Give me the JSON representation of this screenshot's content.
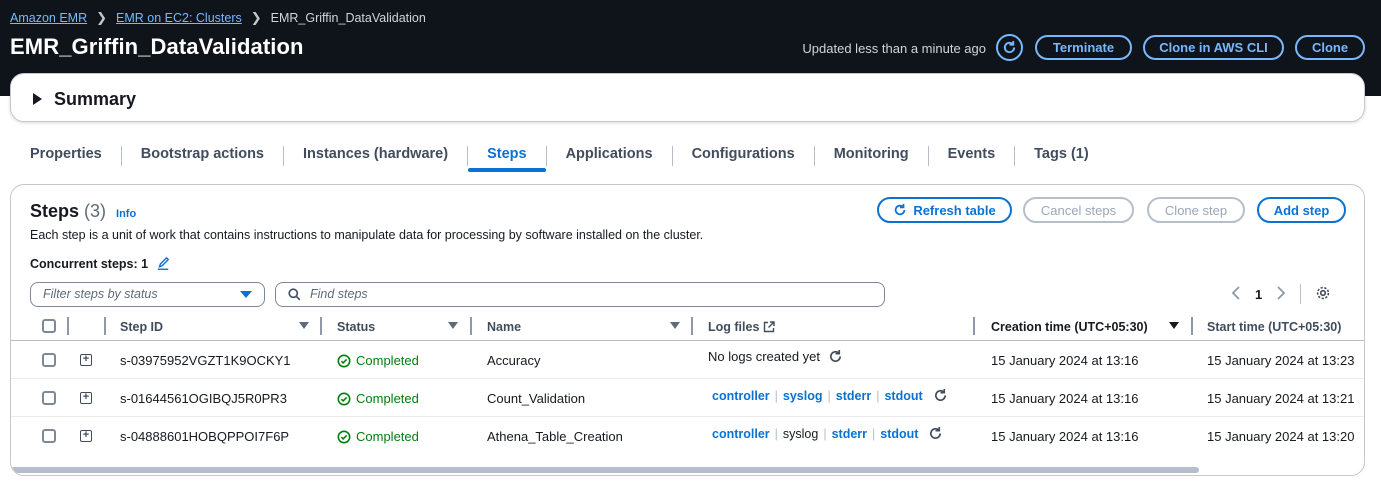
{
  "breadcrumb": {
    "items": [
      "Amazon EMR",
      "EMR on EC2: Clusters"
    ],
    "current": "EMR_Griffin_DataValidation"
  },
  "header": {
    "title": "EMR_Griffin_DataValidation",
    "updated": "Updated less than a minute ago",
    "terminate": "Terminate",
    "clone_cli": "Clone in AWS CLI",
    "clone": "Clone"
  },
  "summary": {
    "label": "Summary"
  },
  "tabs": [
    {
      "label": "Properties"
    },
    {
      "label": "Bootstrap actions"
    },
    {
      "label": "Instances (hardware)"
    },
    {
      "label": "Steps"
    },
    {
      "label": "Applications"
    },
    {
      "label": "Configurations"
    },
    {
      "label": "Monitoring"
    },
    {
      "label": "Events"
    },
    {
      "label": "Tags (1)"
    }
  ],
  "active_tab": "Steps",
  "steps": {
    "title": "Steps",
    "count": "(3)",
    "info": "Info",
    "description": "Each step is a unit of work that contains instructions to manipulate data for processing by software installed on the cluster.",
    "concurrent": "Concurrent steps: 1",
    "refresh": "Refresh table",
    "cancel": "Cancel steps",
    "clone_step": "Clone step",
    "add_step": "Add step",
    "filter_placeholder": "Filter steps by status",
    "search_placeholder": "Find steps",
    "page": "1",
    "columns": {
      "step_id": "Step ID",
      "status": "Status",
      "name": "Name",
      "log_files": "Log files",
      "creation": "Creation time (UTC+05:30)",
      "start": "Start time (UTC+05:30)"
    },
    "rows": [
      {
        "id": "s-03975952VGZT1K9OCKY1",
        "status": "Completed",
        "name": "Accuracy",
        "logs_text": "No logs created yet",
        "created": "15 January 2024 at 13:16",
        "started": "15 January 2024 at 13:23"
      },
      {
        "id": "s-01644561OGIBQJ5R0PR3",
        "status": "Completed",
        "name": "Count_Validation",
        "logs": [
          "controller",
          "syslog",
          "stderr",
          "stdout"
        ],
        "created": "15 January 2024 at 13:16",
        "started": "15 January 2024 at 13:21"
      },
      {
        "id": "s-04888601HOBQPPOI7F6P",
        "status": "Completed",
        "name": "Athena_Table_Creation",
        "logs": [
          "controller",
          "syslog",
          "stderr",
          "stdout"
        ],
        "created": "15 January 2024 at 13:16",
        "started": "15 January 2024 at 13:20"
      }
    ]
  },
  "colors": {
    "header_bg": "#0f141a",
    "link_dark": "#7ab7ff",
    "primary": "#0972d3",
    "success": "#037f0c"
  }
}
